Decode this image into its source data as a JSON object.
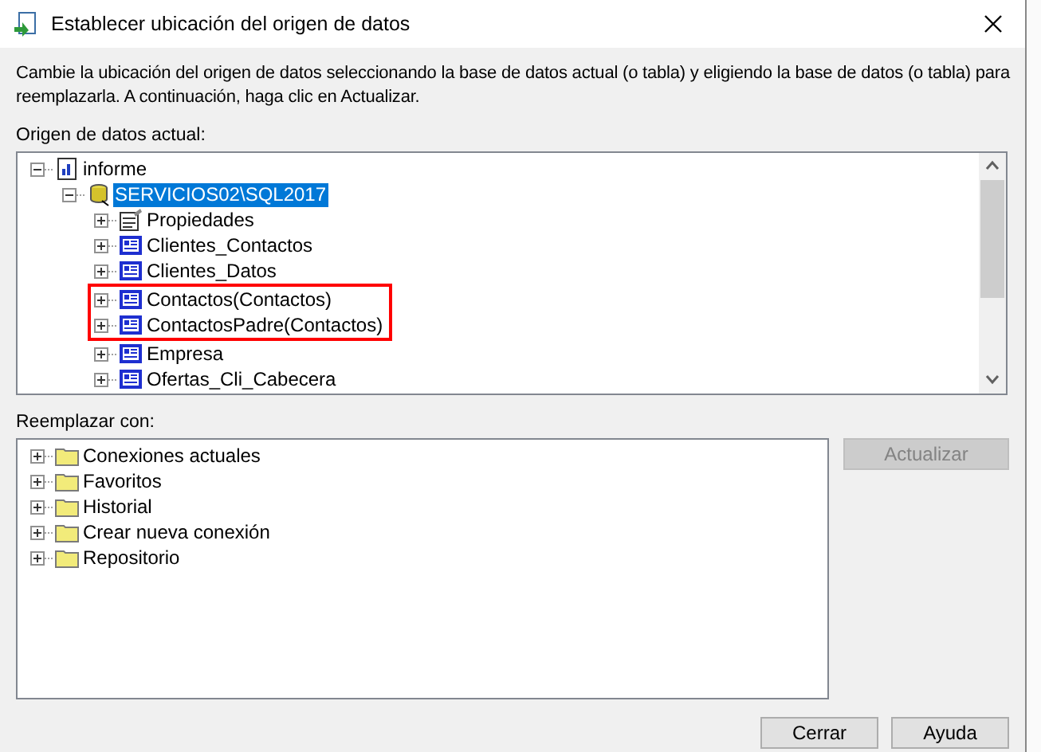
{
  "window": {
    "title": "Establecer ubicación del origen de datos"
  },
  "instructions": "Cambie la ubicación del origen de datos seleccionando la base de datos actual (o tabla) y eligiendo la base de datos (o tabla) para reemplazarla. A continuación, haga clic en Actualizar.",
  "current_source": {
    "label": "Origen de datos actual:",
    "tree": [
      {
        "label": "informe",
        "kind": "report",
        "expanded": true,
        "selected": false,
        "highlighted": false,
        "children": [
          {
            "label": "SERVICIOS02\\SQL2017",
            "kind": "server",
            "expanded": true,
            "selected": true,
            "highlighted": false,
            "children": [
              {
                "label": "Propiedades",
                "kind": "properties",
                "expanded": false,
                "selected": false,
                "highlighted": false
              },
              {
                "label": "Clientes_Contactos",
                "kind": "table",
                "expanded": false,
                "selected": false,
                "highlighted": false
              },
              {
                "label": "Clientes_Datos",
                "kind": "table",
                "expanded": false,
                "selected": false,
                "highlighted": false
              },
              {
                "label": "Contactos(Contactos)",
                "kind": "table",
                "expanded": false,
                "selected": false,
                "highlighted": true
              },
              {
                "label": "ContactosPadre(Contactos)",
                "kind": "table",
                "expanded": false,
                "selected": false,
                "highlighted": true
              },
              {
                "label": "Empresa",
                "kind": "table",
                "expanded": false,
                "selected": false,
                "highlighted": false
              },
              {
                "label": "Ofertas_Cli_Cabecera",
                "kind": "table",
                "expanded": false,
                "selected": false,
                "highlighted": false
              }
            ]
          }
        ]
      }
    ]
  },
  "replace_with": {
    "label": "Reemplazar con:",
    "tree": [
      {
        "label": "Conexiones actuales",
        "kind": "folder",
        "expanded": false,
        "selected": false,
        "highlighted": false
      },
      {
        "label": "Favoritos",
        "kind": "folder",
        "expanded": false,
        "selected": false,
        "highlighted": false
      },
      {
        "label": "Historial",
        "kind": "folder",
        "expanded": false,
        "selected": false,
        "highlighted": false
      },
      {
        "label": "Crear nueva conexión",
        "kind": "folder",
        "expanded": false,
        "selected": false,
        "highlighted": false
      },
      {
        "label": "Repositorio",
        "kind": "folder",
        "expanded": false,
        "selected": false,
        "highlighted": false
      }
    ]
  },
  "update_button": {
    "label": "Actualizar",
    "disabled": true
  },
  "buttons": [
    "Cerrar",
    "Ayuda"
  ]
}
